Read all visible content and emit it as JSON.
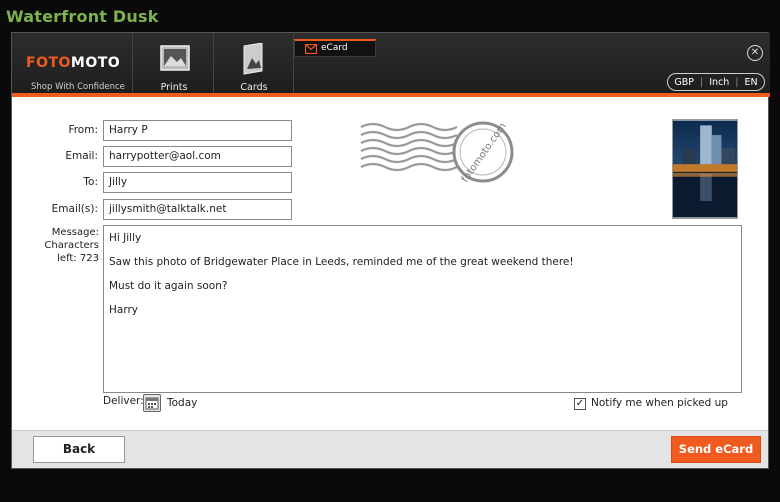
{
  "page": {
    "title": "Waterfront Dusk"
  },
  "brand": {
    "logo_part1": "FOTO",
    "logo_part2": "MOTO",
    "tagline": "Shop With Confidence"
  },
  "nav": {
    "prints_label": "Prints",
    "cards_label": "Cards",
    "ecard_label": "eCard"
  },
  "prefs": {
    "currency": "GBP",
    "unit": "Inch",
    "language": "EN"
  },
  "form": {
    "from_label": "From:",
    "from_value": "Harry P",
    "email_label": "Email:",
    "email_value": "harrypotter@aol.com",
    "to_label": "To:",
    "to_value": "Jilly",
    "emails_label": "Email(s):",
    "emails_value": "jillysmith@talktalk.net",
    "message_label": "Message:",
    "chars_label": "Characters",
    "chars_left": "left: 723",
    "message_lines": [
      "Hi Jilly",
      "Saw this photo of Bridgewater Place in Leeds, reminded me of the great weekend there!",
      "Must do it again soon?",
      "Harry"
    ]
  },
  "stamp_text": "fotomoto.com",
  "deliver": {
    "label": "Deliver:",
    "value": "Today"
  },
  "notify": {
    "label": "Notify me when picked up",
    "checked": true
  },
  "buttons": {
    "back": "Back",
    "send": "Send eCard"
  },
  "colors": {
    "accent": "#ef5a1e",
    "title_green": "#7fb24d",
    "header_bg": "#242424"
  }
}
